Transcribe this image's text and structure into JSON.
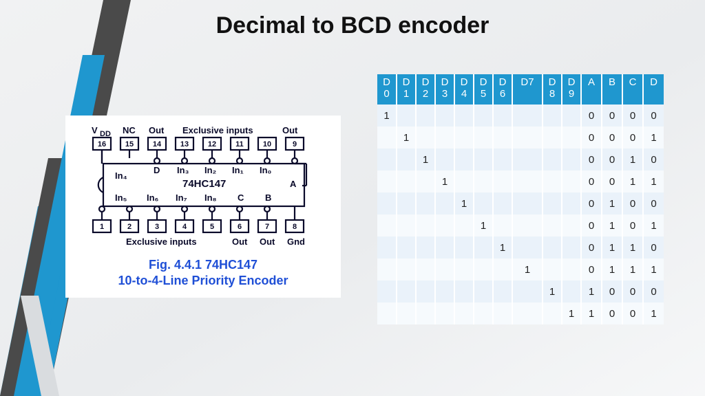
{
  "title": "Decimal to BCD encoder",
  "chip": {
    "top_labels": [
      "V",
      "NC",
      "Out",
      "Exclusive inputs",
      "Out"
    ],
    "vdd_sub": "DD",
    "top_pins": [
      "16",
      "15",
      "14",
      "13",
      "12",
      "11",
      "10",
      "9"
    ],
    "core_top_row": [
      "D",
      "In₃",
      "In₂",
      "In₁",
      "In₀"
    ],
    "part": "74HC147",
    "core_left_top": "In₄",
    "core_left_bottom": "In₅",
    "core_bottom_row": [
      "In₆",
      "In₇",
      "In₈",
      "C",
      "B"
    ],
    "core_right": "A",
    "bottom_pins": [
      "1",
      "2",
      "3",
      "4",
      "5",
      "6",
      "7",
      "8"
    ],
    "bottom_labels": [
      "Exclusive inputs",
      "Out",
      "Out",
      "Gnd"
    ],
    "caption_line1": "Fig. 4.4.1   74HC147",
    "caption_line2": "10-to-4-Line Priority Encoder"
  },
  "table": {
    "headers": [
      "D0",
      "D1",
      "D2",
      "D3",
      "D4",
      "D5",
      "D6",
      "D7",
      "D8",
      "D9",
      "A",
      "B",
      "C",
      "D"
    ],
    "header_breaks": [
      "D\n0",
      "D\n1",
      "D\n2",
      "D\n3",
      "D\n4",
      "D\n5",
      "D\n6",
      "D7",
      "D\n8",
      "D\n9",
      "A",
      "B",
      "C",
      "D"
    ],
    "rows": [
      [
        "1",
        "",
        "",
        "",
        "",
        "",
        "",
        "",
        "",
        "",
        "0",
        "0",
        "0",
        "0"
      ],
      [
        "",
        "1",
        "",
        "",
        "",
        "",
        "",
        "",
        "",
        "",
        "0",
        "0",
        "0",
        "1"
      ],
      [
        "",
        "",
        "1",
        "",
        "",
        "",
        "",
        "",
        "",
        "",
        "0",
        "0",
        "1",
        "0"
      ],
      [
        "",
        "",
        "",
        "1",
        "",
        "",
        "",
        "",
        "",
        "",
        "0",
        "0",
        "1",
        "1"
      ],
      [
        "",
        "",
        "",
        "",
        "1",
        "",
        "",
        "",
        "",
        "",
        "0",
        "1",
        "0",
        "0"
      ],
      [
        "",
        "",
        "",
        "",
        "",
        "1",
        "",
        "",
        "",
        "",
        "0",
        "1",
        "0",
        "1"
      ],
      [
        "",
        "",
        "",
        "",
        "",
        "",
        "1",
        "",
        "",
        "",
        "0",
        "1",
        "1",
        "0"
      ],
      [
        "",
        "",
        "",
        "",
        "",
        "",
        "",
        "1",
        "",
        "",
        "0",
        "1",
        "1",
        "1"
      ],
      [
        "",
        "",
        "",
        "",
        "",
        "",
        "",
        "",
        "1",
        "",
        "1",
        "0",
        "0",
        "0"
      ],
      [
        "",
        "",
        "",
        "",
        "",
        "",
        "",
        "",
        "",
        "1",
        "1",
        "0",
        "0",
        "1"
      ]
    ]
  }
}
